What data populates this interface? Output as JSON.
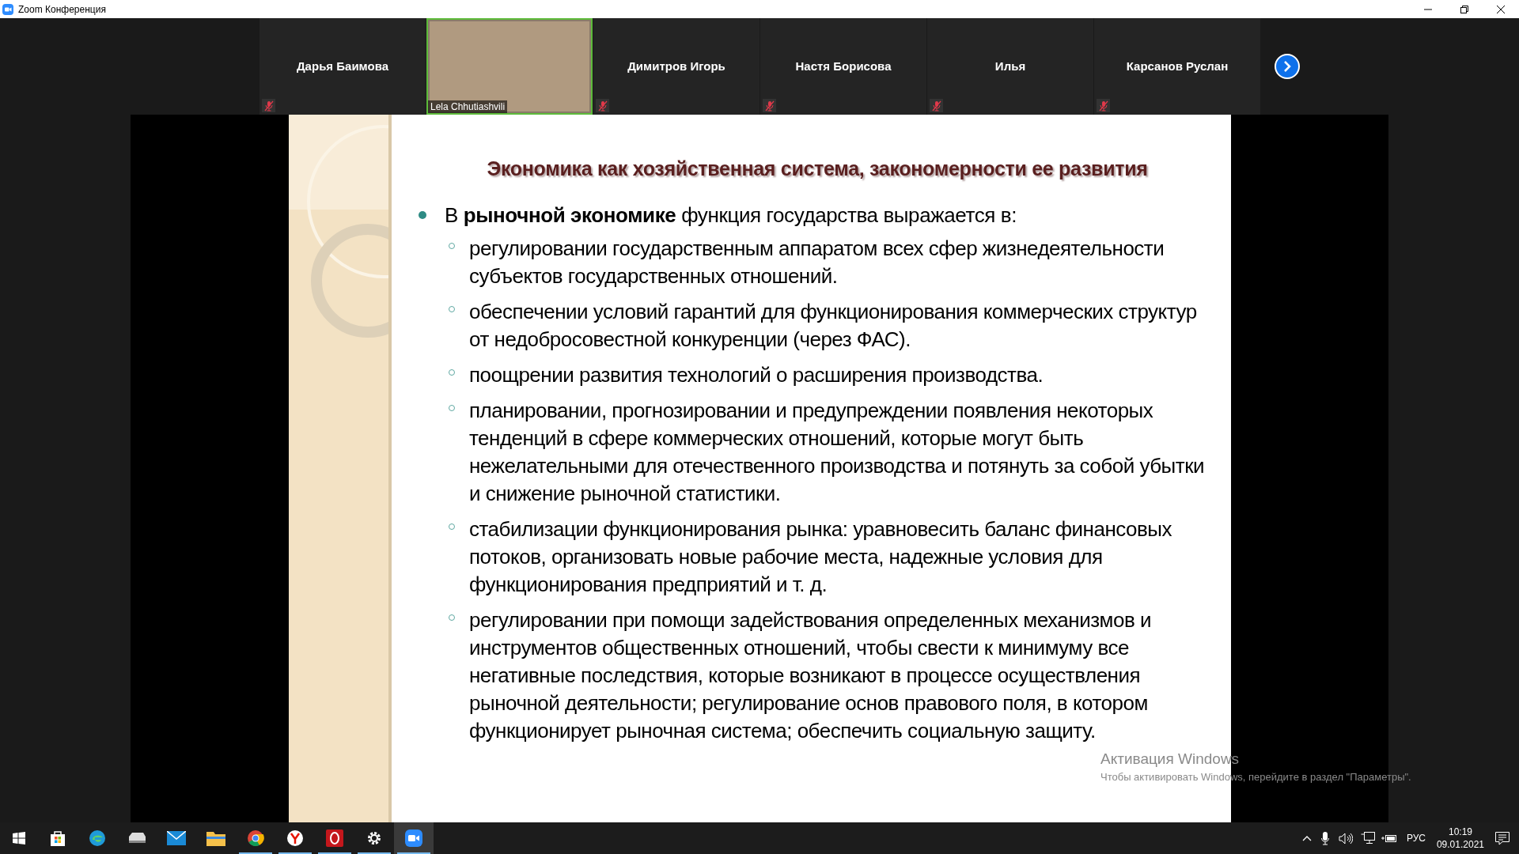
{
  "window": {
    "title": "Zoom Конференция"
  },
  "participants": [
    {
      "name": "Дарья Баимова",
      "kind": "name",
      "muted": true
    },
    {
      "name": "Lela Chhutiashvili",
      "kind": "video",
      "muted": false
    },
    {
      "name": "Димитров Игорь",
      "kind": "name",
      "muted": true
    },
    {
      "name": "Настя Борисова",
      "kind": "name",
      "muted": true
    },
    {
      "name": "Илья",
      "kind": "name",
      "muted": true
    },
    {
      "name": "Карсанов Руслан",
      "kind": "name",
      "muted": true
    }
  ],
  "slide": {
    "title": "Экономика как хозяйственная система, закономерности ее развития",
    "bullet": "В **рыночной экономике** функция государства выражается в:",
    "sub_bullets": [
      "регулировании государственным аппаратом всех сфер жизнедеятельности субъектов государственных отношений.",
      "обеспечении условий гарантий для функционирования коммерческих структур от недобросовестной конкуренции (через ФАС).",
      "поощрении развития технологий о расширения производства.",
      "планировании, прогнозировании и предупреждении появления некоторых тенденций в сфере коммерческих отношений, которые могут быть нежелательными для отечественного производства и потянуть за собой убытки и снижение рыночной статистики.",
      "стабилизации функционирования рынка: уравновесить баланс финансовых потоков, организовать новые рабочие места, надежные условия для функционирования предприятий и т. д.",
      "регулировании при помощи задействования определенных механизмов и инструментов общественных отношений, чтобы свести к минимуму все негативные последствия, которые возникают в процессе осуществления рыночной деятельности; регулирование основ правового поля, в котором функционирует рыночная система; обеспечить социальную защиту."
    ]
  },
  "activation_notice": {
    "title": "Активация Windows",
    "text": "Чтобы активировать Windows, перейдите в раздел \"Параметры\"."
  },
  "taskbar": {
    "apps": [
      {
        "kind": "store",
        "running": false,
        "selected": false
      },
      {
        "kind": "edge",
        "running": false,
        "selected": false
      },
      {
        "kind": "printer",
        "running": false,
        "selected": false
      },
      {
        "kind": "mail",
        "running": false,
        "selected": false
      },
      {
        "kind": "folder",
        "running": false,
        "selected": false
      },
      {
        "kind": "chrome",
        "running": true,
        "selected": false
      },
      {
        "kind": "yandex",
        "running": true,
        "selected": false
      },
      {
        "kind": "opera",
        "running": true,
        "selected": false
      },
      {
        "kind": "settings",
        "running": true,
        "selected": false
      },
      {
        "kind": "zoom",
        "running": true,
        "selected": true
      }
    ],
    "language": "РУС",
    "time": "10:19",
    "date": "09.01.2021"
  }
}
